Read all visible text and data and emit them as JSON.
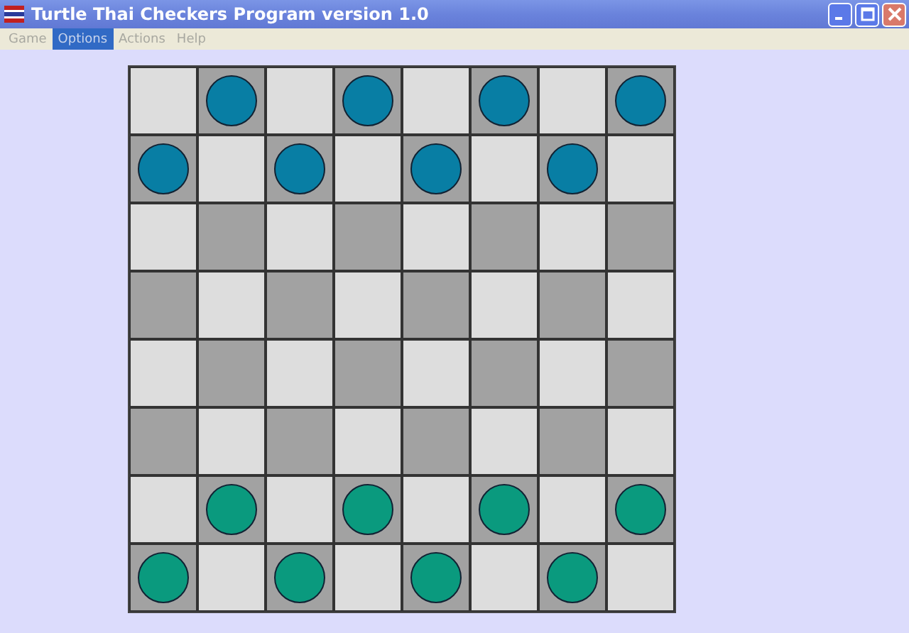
{
  "window": {
    "title": "Turtle Thai Checkers Program version 1.0"
  },
  "menu": [
    {
      "label": "Game",
      "selected": false
    },
    {
      "label": "Options",
      "selected": true
    },
    {
      "label": "Actions",
      "selected": false
    },
    {
      "label": "Help",
      "selected": false
    }
  ],
  "board": [
    [
      {
        "kind": "empty"
      },
      {
        "kind": "piece",
        "color": "#087ea4"
      },
      {
        "kind": "empty"
      },
      {
        "kind": "piece",
        "color": "#087ea4"
      },
      {
        "kind": "empty"
      },
      {
        "kind": "piece",
        "color": "#087ea4"
      },
      {
        "kind": "empty"
      },
      {
        "kind": "piece",
        "color": "#087ea4"
      }
    ],
    [
      {
        "kind": "piece",
        "color": "#087ea4"
      },
      {
        "kind": "empty"
      },
      {
        "kind": "piece",
        "color": "#087ea4"
      },
      {
        "kind": "empty"
      },
      {
        "kind": "piece",
        "color": "#087ea4"
      },
      {
        "kind": "empty"
      },
      {
        "kind": "piece",
        "color": "#087ea4"
      },
      {
        "kind": "empty"
      }
    ],
    [
      {
        "kind": "empty"
      },
      {
        "kind": "empty"
      },
      {
        "kind": "empty"
      },
      {
        "kind": "empty"
      },
      {
        "kind": "empty"
      },
      {
        "kind": "empty"
      },
      {
        "kind": "empty"
      },
      {
        "kind": "empty"
      }
    ],
    [
      {
        "kind": "empty"
      },
      {
        "kind": "empty"
      },
      {
        "kind": "empty"
      },
      {
        "kind": "empty"
      },
      {
        "kind": "empty"
      },
      {
        "kind": "empty"
      },
      {
        "kind": "empty"
      },
      {
        "kind": "empty"
      }
    ],
    [
      {
        "kind": "empty"
      },
      {
        "kind": "empty"
      },
      {
        "kind": "empty"
      },
      {
        "kind": "empty"
      },
      {
        "kind": "empty"
      },
      {
        "kind": "empty"
      },
      {
        "kind": "empty"
      },
      {
        "kind": "empty"
      }
    ],
    [
      {
        "kind": "empty"
      },
      {
        "kind": "empty"
      },
      {
        "kind": "empty"
      },
      {
        "kind": "empty"
      },
      {
        "kind": "empty"
      },
      {
        "kind": "empty"
      },
      {
        "kind": "empty"
      },
      {
        "kind": "empty"
      }
    ],
    [
      {
        "kind": "empty"
      },
      {
        "kind": "piece",
        "color": "#0a9a7e"
      },
      {
        "kind": "empty"
      },
      {
        "kind": "piece",
        "color": "#0a9a7e"
      },
      {
        "kind": "empty"
      },
      {
        "kind": "piece",
        "color": "#0a9a7e"
      },
      {
        "kind": "empty"
      },
      {
        "kind": "piece",
        "color": "#0a9a7e"
      }
    ],
    [
      {
        "kind": "piece",
        "color": "#0a9a7e"
      },
      {
        "kind": "empty"
      },
      {
        "kind": "piece",
        "color": "#0a9a7e"
      },
      {
        "kind": "empty"
      },
      {
        "kind": "piece",
        "color": "#0a9a7e"
      },
      {
        "kind": "empty"
      },
      {
        "kind": "piece",
        "color": "#0a9a7e"
      },
      {
        "kind": "empty"
      }
    ]
  ]
}
